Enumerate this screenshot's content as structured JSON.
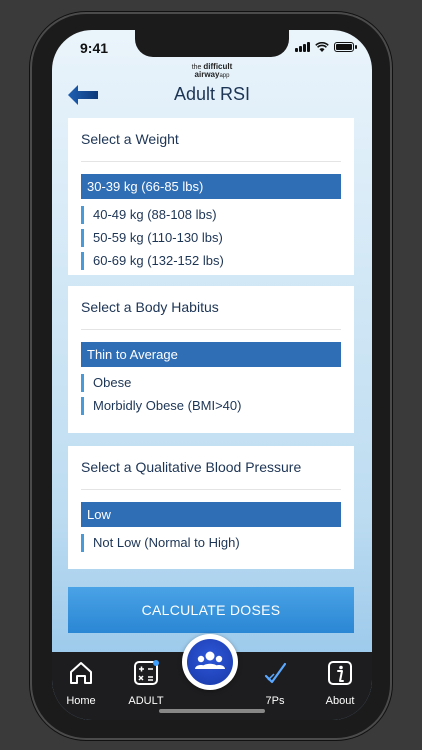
{
  "status": {
    "time": "9:41"
  },
  "brand": {
    "line1_prefix": "the",
    "line1_bold": "difficult",
    "line2": "airway",
    "line2_suffix": "app"
  },
  "header": {
    "title": "Adult RSI"
  },
  "weight": {
    "heading": "Select a Weight",
    "selected": "30-39 kg (66-85 lbs)",
    "options": [
      "40-49 kg (88-108 lbs)",
      "50-59 kg (110-130 lbs)",
      "60-69 kg (132-152 lbs)"
    ]
  },
  "habitus": {
    "heading": "Select a Body Habitus",
    "selected": "Thin to Average",
    "options": [
      "Obese",
      "Morbidly Obese (BMI>40)"
    ]
  },
  "bp": {
    "heading": "Select a Qualitative Blood Pressure",
    "selected": "Low",
    "options": [
      "Not Low (Normal to High)"
    ]
  },
  "calculate_label": "CALCULATE  DOSES",
  "tabbar": {
    "home": "Home",
    "adult": "ADULT",
    "sevenps": "7Ps",
    "about": "About"
  },
  "colors": {
    "accent": "#2f6db5",
    "option_bar": "#4a9ad9",
    "text": "#1d3555"
  }
}
